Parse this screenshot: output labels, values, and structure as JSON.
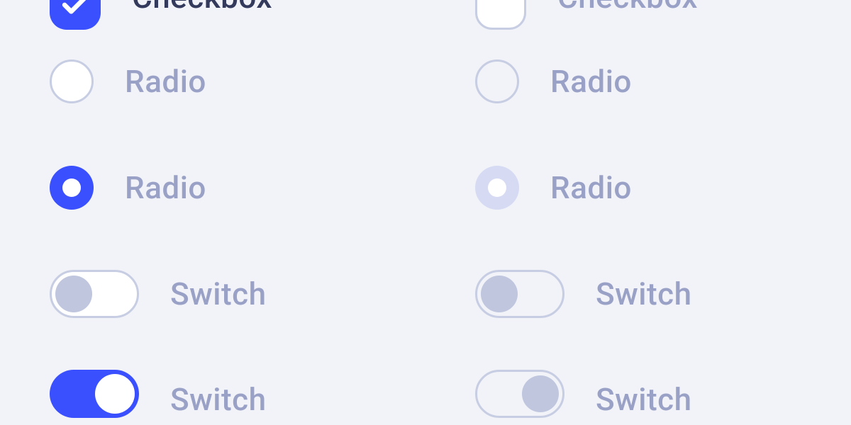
{
  "left": {
    "checkbox": {
      "label": "Checkbox",
      "checked": true
    },
    "radio1": {
      "label": "Radio",
      "selected": false
    },
    "radio2": {
      "label": "Radio",
      "selected": true
    },
    "switch1": {
      "label": "Switch",
      "on": false
    },
    "switch2": {
      "label": "Switch",
      "on": true
    }
  },
  "right": {
    "checkbox": {
      "label": "Checkbox",
      "checked": false
    },
    "radio1": {
      "label": "Radio",
      "selected": false
    },
    "radio2": {
      "label": "Radio",
      "selected": true
    },
    "switch1": {
      "label": "Switch",
      "on": false
    },
    "switch2": {
      "label": "Switch",
      "on": true
    }
  },
  "colors": {
    "accent": "#3a50ff",
    "label": "#9aa1c6"
  }
}
